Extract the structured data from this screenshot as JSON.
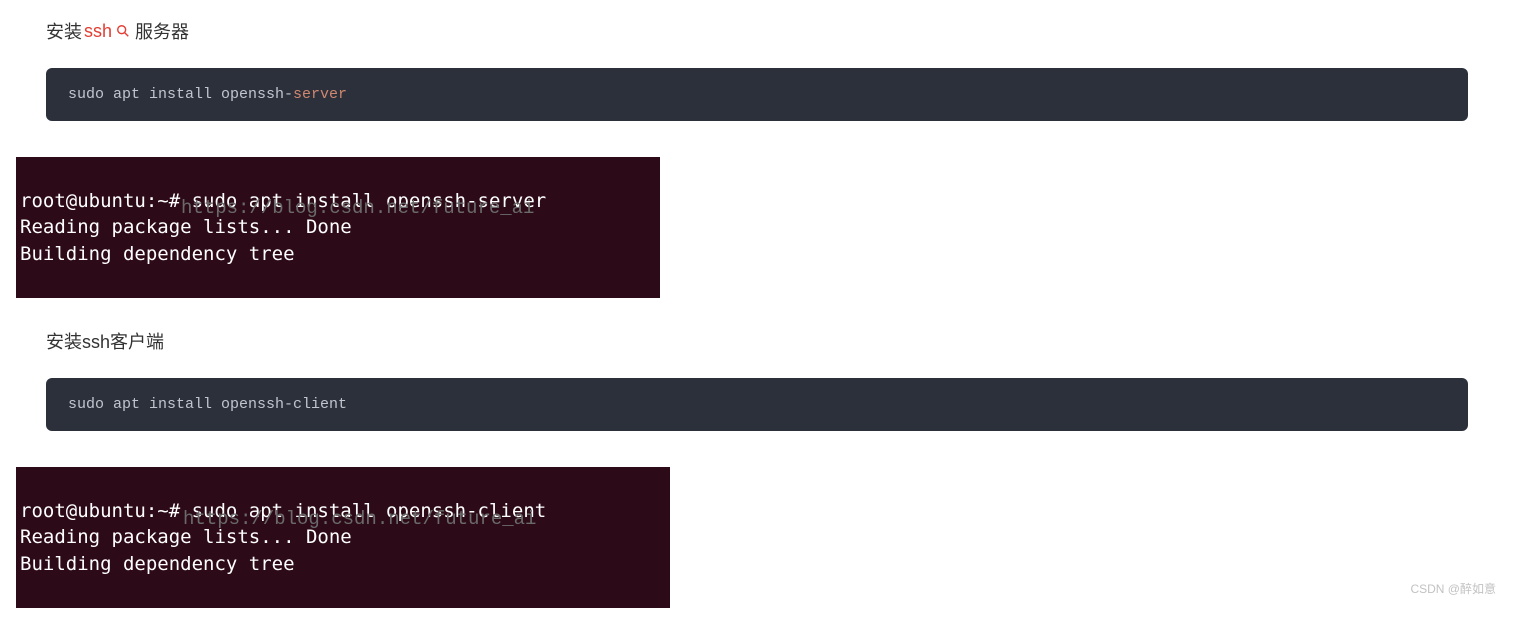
{
  "section1": {
    "heading_pre": "安装",
    "heading_ssh": "ssh",
    "heading_post": "服务器",
    "code_prefix": "sudo apt install openssh-",
    "code_keyword": "server",
    "terminal_line1": "root@ubuntu:~# sudo apt install openssh-server",
    "terminal_line2": "Reading package lists... Done",
    "terminal_line3": "Building dependency tree",
    "watermark_text": "https://blog.csdn.net/future_ai"
  },
  "section2": {
    "heading": "安装ssh客户端",
    "code_full": "sudo apt install openssh-client",
    "terminal_line1": "root@ubuntu:~# sudo apt install openssh-client",
    "terminal_line2": "Reading package lists... Done",
    "terminal_line3": "Building dependency tree",
    "watermark_text": "https://blog.csdn.net/future_ai"
  },
  "corner_watermark": "CSDN @醉如意"
}
